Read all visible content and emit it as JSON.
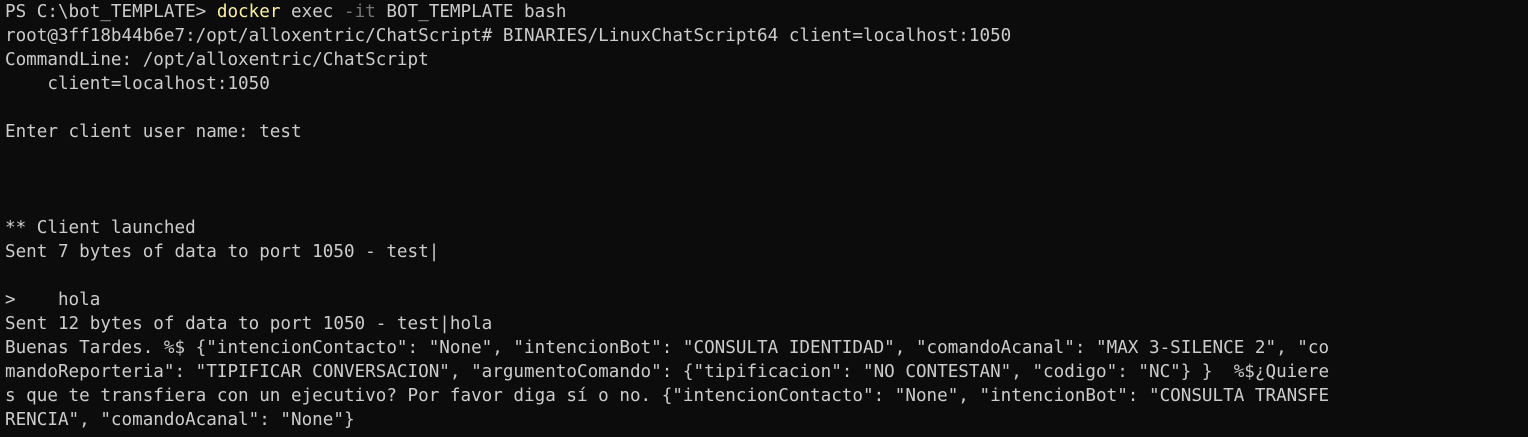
{
  "terminal": {
    "prompt_line": {
      "prompt": "PS C:\\bot_TEMPLATE> ",
      "command": "docker",
      "arg1": " exec ",
      "flag": "-it",
      "rest": " BOT_TEMPLATE bash"
    },
    "lines": [
      "root@3ff18b44b6e7:/opt/alloxentric/ChatScript# BINARIES/LinuxChatScript64 client=localhost:1050",
      "CommandLine: /opt/alloxentric/ChatScript",
      "    client=localhost:1050",
      "",
      "Enter client user name: test",
      "",
      "",
      "",
      "** Client launched",
      "Sent 7 bytes of data to port 1050 - test|",
      "",
      ">    hola",
      "Sent 12 bytes of data to port 1050 - test|hola",
      "Buenas Tardes. %$ {\"intencionContacto\": \"None\", \"intencionBot\": \"CONSULTA IDENTIDAD\", \"comandoAcanal\": \"MAX 3-SILENCE 2\", \"co",
      "mandoReporteria\": \"TIPIFICAR CONVERSACION\", \"argumentoComando\": {\"tipificacion\": \"NO CONTESTAN\", \"codigo\": \"NC\"} }  %$¿Quiere",
      "s que te transfiera con un ejecutivo? Por favor diga sí o no. {\"intencionContacto\": \"None\", \"intencionBot\": \"CONSULTA TRANSFE",
      "RENCIA\", \"comandoAcanal\": \"None\"}"
    ],
    "colors": {
      "background": "#0c0c0c",
      "foreground": "#cccccc",
      "command": "#f9f1a5",
      "flag": "#767676"
    }
  }
}
